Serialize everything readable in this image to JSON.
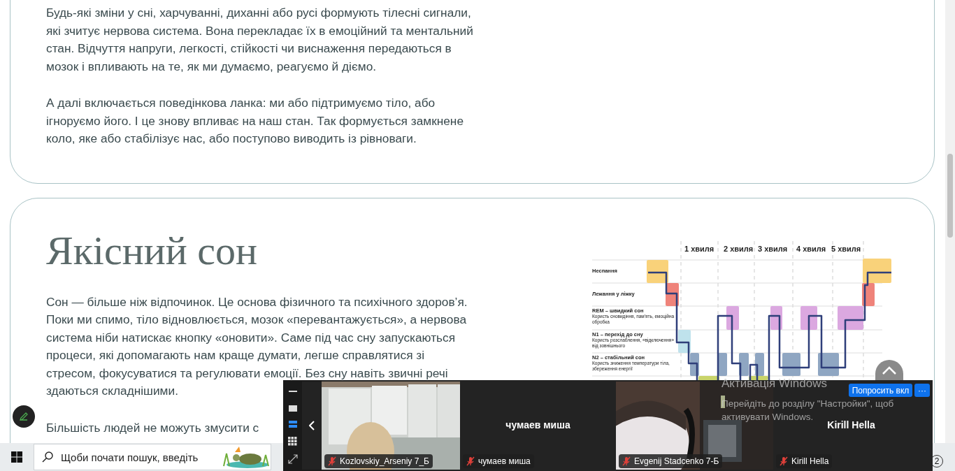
{
  "article": {
    "cards": [
      {
        "paragraphs": [
          {
            "lines": [
              "Будь-які зміни у сні, харчуванні, диханні або русі формують тілесні сигнали,",
              "які зчитує нервова система. Вона перекладає їх в емоційний та ментальний",
              "стан. Відчуття напруги, легкості, стійкості чи виснаження передаються в",
              "мозок і впливають на те, як ми думаємо, реагуємо й діємо."
            ]
          },
          {
            "lines": [
              "А далі включається поведінкова ланка: ми або підтримуємо тіло, або",
              "ігноруємо його. І це знову впливає на наш стан. Так формується замкнене",
              "коло, яке або стабілізує нас, або поступово виводить із рівноваги."
            ]
          }
        ]
      },
      {
        "heading": "Якісний сон",
        "paragraphs": [
          {
            "lines": [
              "Сон — більше ніж відпочинок. Це основа фізичного та психічного здоров’я.",
              "Поки ми спимо, тіло відновлюється, мозок «перевантажується», а нервова",
              "система ніби натискає кнопку «оновити». Саме під час сну запускаються",
              "процеси, які допомагають нам краще думати, легше справлятися зі",
              "стресом, фокусуватися та регулювати емоції. Без сну навіть звичні речі",
              "здаються складнішими."
            ]
          },
          {
            "lines": [
              "Більшість людей не можуть змусити с"
            ]
          }
        ],
        "diagram": {
          "waves": [
            "1 хвиля",
            "2 хвиля",
            "3 хвиля",
            "4 хвиля",
            "5 хвиля"
          ],
          "stages": [
            {
              "title": "Неспання"
            },
            {
              "title": "Лежання у ліжку"
            },
            {
              "title": "REM – швидкий сон",
              "note": "Користь сновидіння, пам'ять, емоційна обробка"
            },
            {
              "title": "N1 – перехід до сну",
              "note": "Користь розслаблення, «відключення» від зовнішнього"
            },
            {
              "title": "N2 – стабільний сон",
              "note": "Користь зниження температури тіла, збереження енергії"
            }
          ]
        }
      }
    ]
  },
  "video_call": {
    "view_modes": [
      {
        "selected": false
      },
      {
        "selected": false
      },
      {
        "selected": true
      },
      {
        "selected": false
      }
    ],
    "tiles": [
      {
        "kind": "video",
        "name": "Kozlovskiy_Arseniy 7_Б",
        "muted": true
      },
      {
        "kind": "avatar",
        "display_name": "чумаев миша",
        "name": "чумаев миша",
        "muted": true
      },
      {
        "kind": "video",
        "name": "Evgenij Stadcenko 7-Б",
        "muted": true
      },
      {
        "kind": "avatar",
        "display_name": "Kirill Hella",
        "name": "Kirill Hella",
        "muted": true
      }
    ],
    "request_button": "Попросить вкл",
    "more_button": "···"
  },
  "activation_notice": {
    "title": "Активація Windows",
    "lines": [
      "Перейдіть до розділу \"Настройки\", щоб",
      "активувати Windows."
    ]
  },
  "taskbar": {
    "search": {
      "placeholder": "Щоби почати пошук, введіть"
    },
    "notification_count": "2"
  }
}
